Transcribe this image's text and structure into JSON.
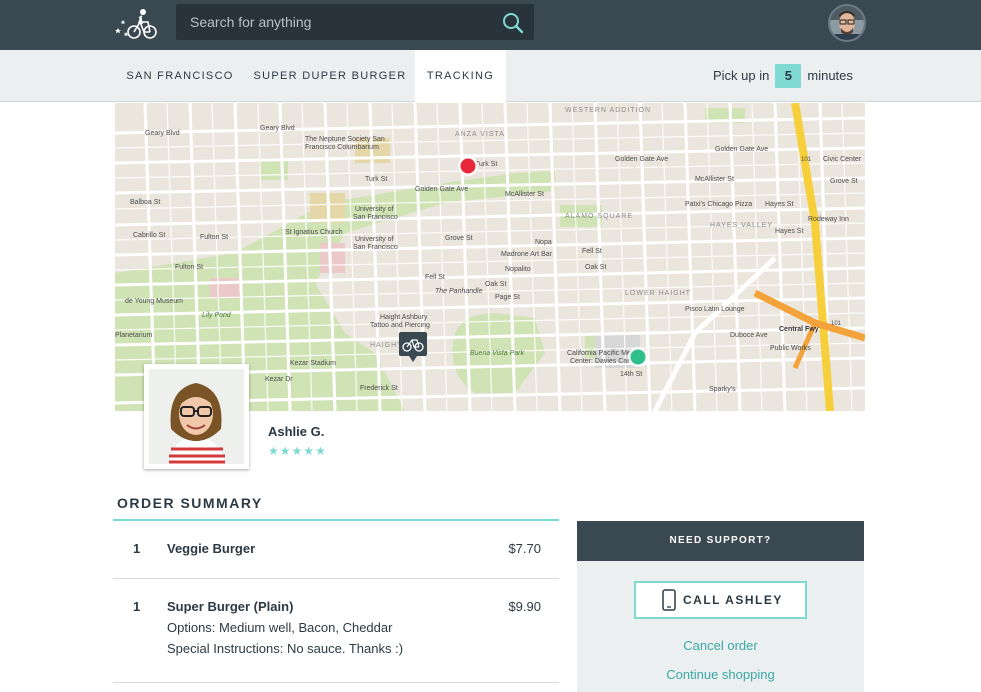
{
  "header": {
    "search": {
      "placeholder": "Search for anything"
    }
  },
  "nav": {
    "tabs": [
      {
        "label": "SAN FRANCISCO"
      },
      {
        "label": "SUPER DUPER BURGER"
      },
      {
        "label": "TRACKING"
      }
    ],
    "pickup_prefix": "Pick up in",
    "pickup_minutes": "5",
    "pickup_suffix": "minutes"
  },
  "map": {
    "streets": {
      "geary": "Geary Blvd",
      "geary2": "Geary Blvd",
      "neptune": "The Neptune Society San",
      "neptune2": "Francisco Columbarium",
      "anza": "ANZA VISTA",
      "western": "WESTERN ADDITION",
      "turk": "Turk St",
      "turk2": "Turk St",
      "golden": "Golden Gate Ave",
      "golden2": "Golden Gate Ave",
      "golden3": "Golden Gate Ave",
      "balboa": "Balboa St",
      "cabrillo": "Cabrillo St",
      "fulton": "Fulton St",
      "fulton2": "Fulton St",
      "usf": "University of",
      "usf2": "San Francisco",
      "ignatius": "St Ignatius Church",
      "usf3": "University of",
      "usf4": "San Francisco",
      "mcallister": "McAllister St",
      "mcallister2": "McAllister St",
      "grove": "Grove St",
      "fell": "Fell St",
      "fell2": "Fell St",
      "oak": "Oak St",
      "oak2": "Oak St",
      "panhandle": "The Panhandle",
      "page": "Page St",
      "lowerhaight": "LOWER HAIGHT",
      "alamo": "ALAMO SQUARE",
      "hayesvalley": "HAYES VALLEY",
      "hayes": "Hayes St",
      "patxi": "Patxi's Chicago Pizza",
      "haightash": "Haight Ashbury",
      "haightash2": "Tattoo and Piercing",
      "haight": "HAIGHT",
      "buena": "Buena Vista Park",
      "deyoung": "de Young Museum",
      "lily": "Lily Pond",
      "planetarium": "Planetarium",
      "kezar": "Kezar Stadium",
      "kezar2": "Kezar Dr",
      "frederick": "Frederick St",
      "cpmc": "California Pacific Medical",
      "cpmc2": "Center: Davies Campus",
      "fourteenth": "14th St",
      "sparky": "Sparky's",
      "pisco": "Pisco Latin Lounge",
      "duboce": "Duboce Ave",
      "central": "Central Fwy",
      "public": "Public Works",
      "civic": "Civic Center",
      "rodeway": "Rodeway Inn",
      "nopa": "Nopa",
      "artbar": "Madrone Art Bar",
      "nopalito": "Nopalito",
      "hayes2": "Hayes St",
      "grove2": "Grove St",
      "hwy": "101",
      "hwy2": "101"
    },
    "marker_colors": {
      "destination": "#e8283a",
      "driver": "#2dc08d"
    },
    "bike_icon": "bicycle-icon"
  },
  "driver": {
    "name": "Ashlie G.",
    "stars": "★★★★★",
    "rating": 4.5
  },
  "order": {
    "title": "ORDER SUMMARY",
    "items": [
      {
        "qty": "1",
        "name": "Veggie Burger",
        "price": "$7.70"
      },
      {
        "qty": "1",
        "name": "Super Burger (Plain)",
        "price": "$9.90",
        "options": "Options: Medium well, Bacon, Cheddar",
        "instructions": "Special Instructions: No sauce. Thanks :)"
      }
    ]
  },
  "support": {
    "title": "NEED SUPPORT?",
    "call_label": "CALL ASHLEY",
    "cancel": "Cancel order",
    "continue": "Continue shopping"
  },
  "colors": {
    "header_bg": "#3a4852",
    "accent": "#7fd9d3",
    "link": "#3aa8a5"
  }
}
